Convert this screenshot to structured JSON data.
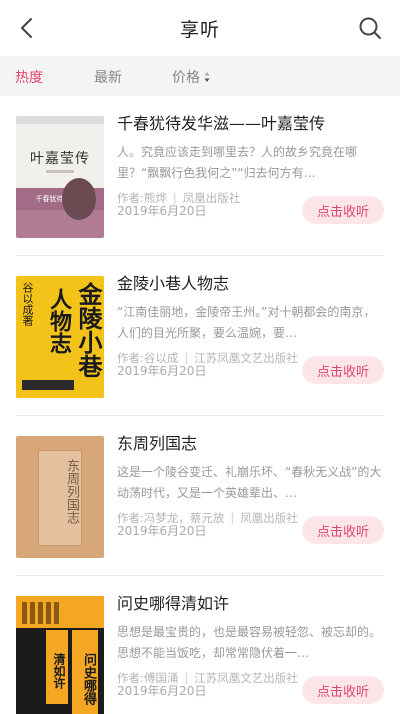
{
  "header": {
    "title": "享听",
    "back_icon": "chevron-left-icon",
    "search_icon": "search-icon"
  },
  "tabs": [
    {
      "label": "热度",
      "active": true
    },
    {
      "label": "最新",
      "active": false
    },
    {
      "label": "价格",
      "active": false,
      "icon": "sort-icon"
    }
  ],
  "colors": {
    "accent": "#e2466e",
    "button_bg": "#fde5ea",
    "tab_bar_bg": "#f4f4f4"
  },
  "books": [
    {
      "title": "千春犹待发华滋——叶嘉莹传",
      "description": "人。究竟应该走到哪里去？人的故乡究竟在哪里？“飘飘行色我何之”“归去何方有…",
      "author": "作者:熊烨",
      "publisher": "凤凰出版社",
      "date": "2019年6月20日",
      "button": "点击收听",
      "cover_text": "叶嘉莹传",
      "cover_band": "千春犹待发华滋"
    },
    {
      "title": "金陵小巷人物志",
      "description": "“江南佳丽地，金陵帝王州。”对十朝都会的南京，人们的目光所聚，要么温婉，要…",
      "author": "作者:谷以成",
      "publisher": "江苏凤凰文艺出版社",
      "date": "2019年6月20日",
      "button": "点击收听",
      "cover_text_1": "金陵小巷",
      "cover_text_2": "人物志",
      "cover_author": "谷以成著"
    },
    {
      "title": "东周列国志",
      "description": "这是一个陵谷变迁、礼崩乐坏、“春秋无义战”的大动荡时代，又是一个英雄辈出、…",
      "author": "作者:冯梦龙，蔡元放",
      "publisher": "凤凰出版社",
      "date": "2019年6月20日",
      "button": "点击收听",
      "cover_text": "东周列国志"
    },
    {
      "title": "问史哪得清如许",
      "description": "思想是最宝贵的，也是最容易被轻忽、被忘却的。思想不能当饭吃，却常常隐伏着一…",
      "author": "作者:傅国涌",
      "publisher": "江苏凤凰文艺出版社",
      "date": "2019年6月20日",
      "button": "点击收听",
      "cover_text_1": "清如许",
      "cover_text_2": "问史哪得"
    }
  ]
}
